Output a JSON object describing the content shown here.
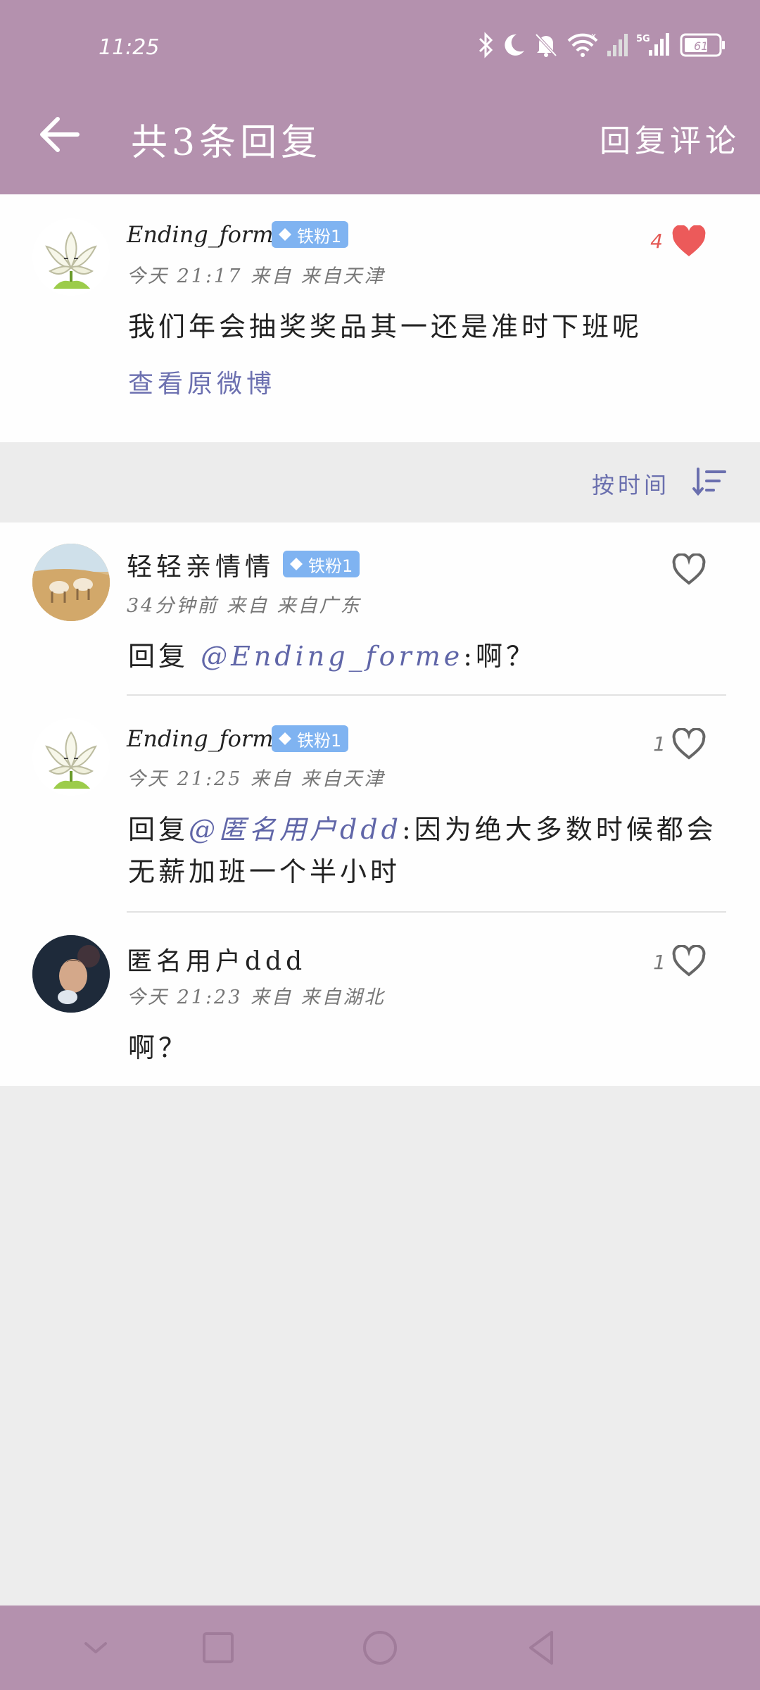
{
  "status_bar": {
    "time": "11:25",
    "battery": "61"
  },
  "header": {
    "title": "共3条回复",
    "action": "回复评论"
  },
  "original": {
    "name": "Ending_forme",
    "badge": "铁粉1",
    "meta": "今天 21:17 来自 来自天津",
    "likes": "4",
    "text": "我们年会抽奖奖品其一还是准时下班呢",
    "link": "查看原微博"
  },
  "sort": {
    "label": "按时间"
  },
  "replies": [
    {
      "name": "轻轻亲情情",
      "badge": "铁粉1",
      "meta": "34分钟前 来自 来自广东",
      "likes": "",
      "prefix": "回复 ",
      "mention": "@Ending_forme",
      "text": ":啊？"
    },
    {
      "name": "Ending_forme",
      "badge": "铁粉1",
      "meta": "今天 21:25 来自 来自天津",
      "likes": "1",
      "prefix": "回复",
      "mention": "@匿名用户ddd",
      "text": ":因为绝大多数时候都会无薪加班一个半小时"
    },
    {
      "name": "匿名用户ddd",
      "meta": "今天 21:23 来自 来自湖北",
      "likes": "1",
      "text": "啊？"
    }
  ],
  "colors": {
    "header_bg": "#b491ae",
    "accent_link": "#6c70b0",
    "badge_bg": "#7fb3f1",
    "like_red": "#e45a55"
  },
  "icons": [
    "back-arrow-icon",
    "heart-icon",
    "sort-icon",
    "gem-icon",
    "bluetooth-icon",
    "moon-icon",
    "mute-bell-icon",
    "wifi-icon",
    "signal-icon",
    "battery-icon",
    "nav-back-icon",
    "nav-home-icon",
    "nav-recents-icon",
    "nav-down-icon"
  ]
}
